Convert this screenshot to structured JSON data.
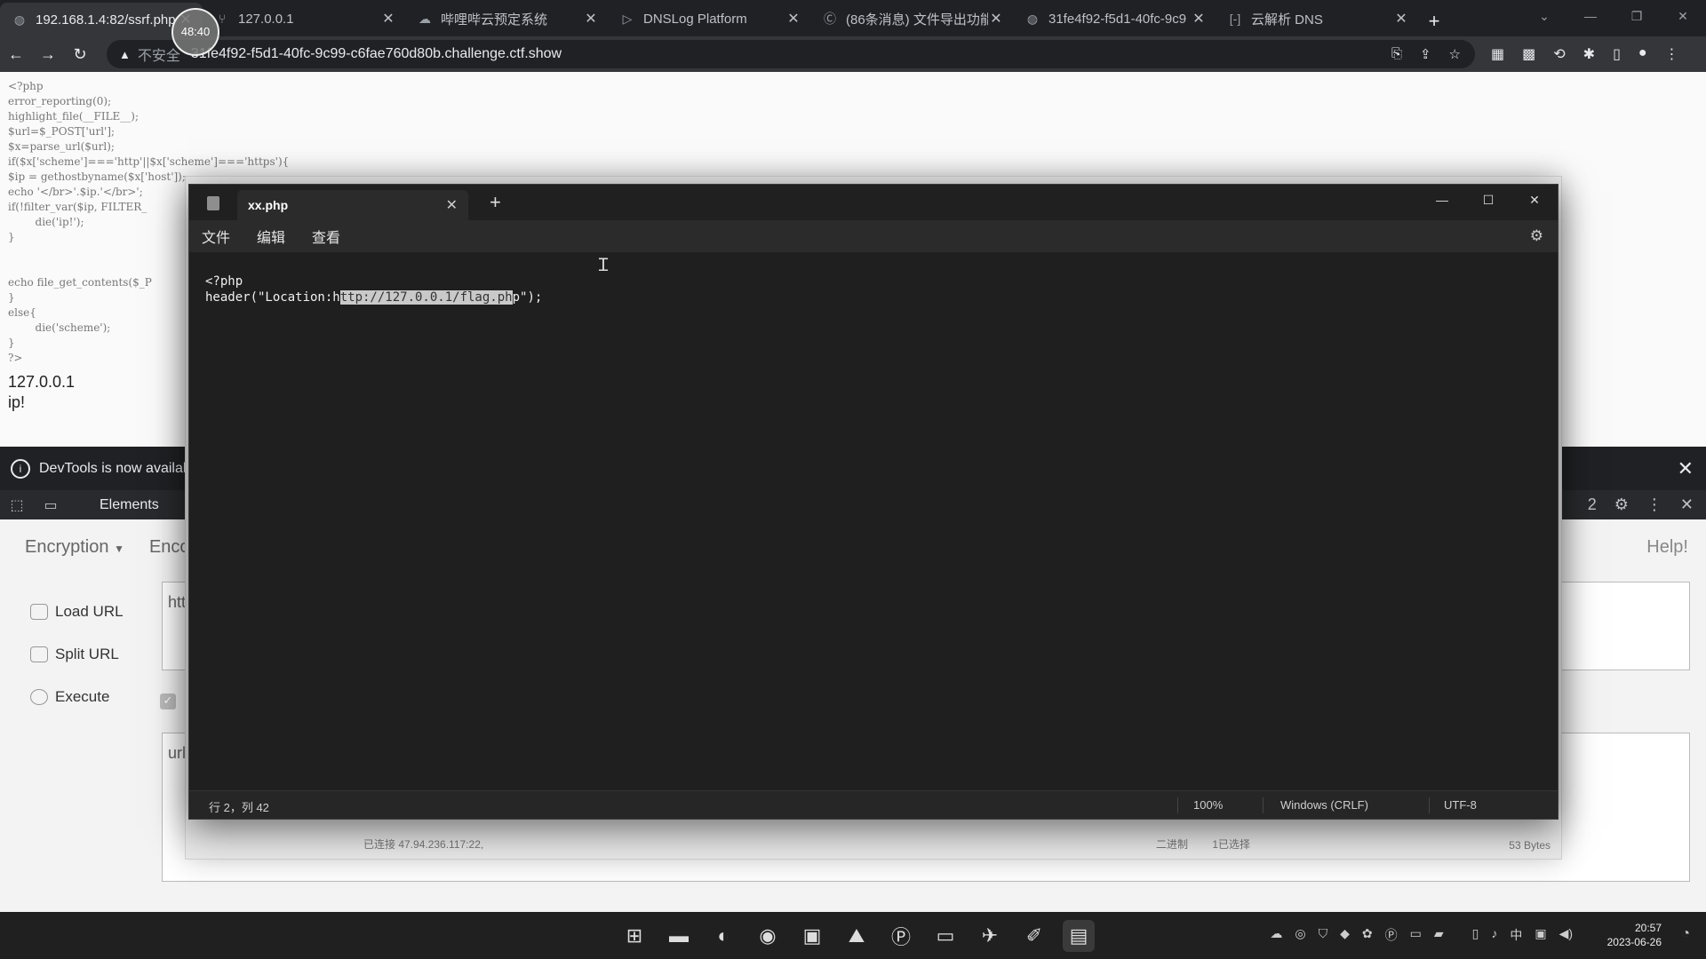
{
  "browser": {
    "tabs": [
      {
        "title": "192.168.1.4:82/ssrf.php",
        "icon": "globe-icon",
        "active": true
      },
      {
        "title": "127.0.0.1",
        "icon": "fork-icon"
      },
      {
        "title": "哔哩哔云预定系统",
        "icon": "cloud-icon"
      },
      {
        "title": "DNSLog Platform",
        "icon": "play-icon"
      },
      {
        "title": "(86条消息) 文件导出功能",
        "icon": "csdn-icon"
      },
      {
        "title": "31fe4f92-f5d1-40fc-9c9",
        "icon": "globe-icon"
      },
      {
        "title": "云解析 DNS",
        "icon": "bracket-icon"
      }
    ],
    "address": {
      "insecure_label": "不安全",
      "url": "31fe4f92-f5d1-40fc-9c99-c6fae760d80b.challenge.ctf.show"
    }
  },
  "page": {
    "source_lines": [
      "<?php",
      "error_reporting(0);",
      "highlight_file(__FILE__);",
      "$url=$_POST['url'];",
      "$x=parse_url($url);",
      "if($x['scheme']==='http'||$x['scheme']==='https'){",
      "$ip = gethostbyname($x['host']);",
      "echo '</br>'.$ip.'</br>';",
      "if(!filter_var($ip, FILTER_",
      "        die('ip!');",
      "}",
      "",
      "",
      "echo file_get_contents($_P",
      "}",
      "else{",
      "        die('scheme');",
      "}",
      "?>"
    ],
    "output_ip": "127.0.0.1",
    "output_msg": "ip!"
  },
  "devtools": {
    "banner": "DevTools is now availal",
    "tab_elements": "Elements",
    "issues_count": "2"
  },
  "hackbar": {
    "menu": [
      "Encryption",
      "Enco"
    ],
    "help": "Help!",
    "load_url": "Load URL",
    "split_url": "Split URL",
    "execute": "Execute",
    "url_value": "htt",
    "post_value": "url"
  },
  "ghost_window": {
    "status_left": "已连接 47.94.236.117:22,",
    "status_mid1": "二进制",
    "status_mid2": "1已选择",
    "status_right": "53 Bytes"
  },
  "notepad": {
    "tab_title": "xx.php",
    "menu": [
      "文件",
      "编辑",
      "查看"
    ],
    "line1": "<?php",
    "line2_pre": "header(\"Location:h",
    "line2_sel": "ttp://127.0.0.1/flag.ph",
    "line2_post": "p\");",
    "status_pos": "行 2，列 42",
    "status_zoom": "100%",
    "status_eol": "Windows (CRLF)",
    "status_enc": "UTF-8"
  },
  "recording": "48:40",
  "taskbar": {
    "apps": [
      "windows-icon",
      "folder-icon",
      "edge-icon",
      "chrome-icon",
      "box-icon",
      "photos-icon",
      "p-app-icon",
      "terminal-icon",
      "bird-icon",
      "fish-icon",
      "notepad-icon"
    ],
    "time": "20:57",
    "date": "2023-06-26",
    "ime": "中"
  }
}
